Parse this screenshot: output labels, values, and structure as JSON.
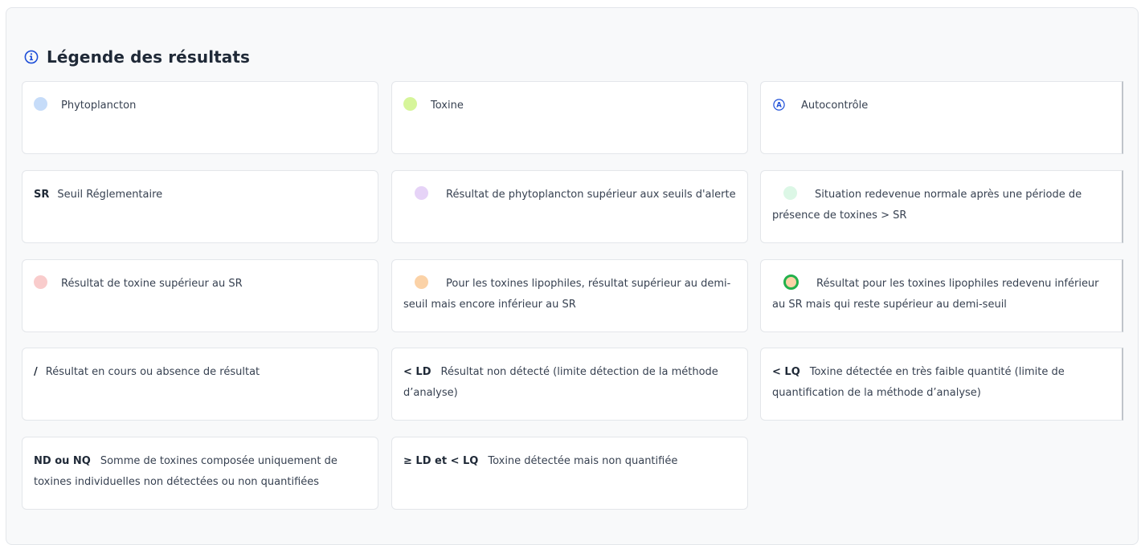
{
  "legend": {
    "title": "Légende des résultats",
    "colors": {
      "phyto": "#c6dcf9",
      "toxine": "#d6f59a",
      "alerte": "#e6d3f7",
      "normale": "#dcf7e6",
      "toxine_sr": "#f9cccc",
      "demi_seuil": "#fbd2a7",
      "ring": "#22b14c",
      "icon_blue": "#1e4fd8"
    },
    "items": [
      {
        "label": "Phytoplancton"
      },
      {
        "label": "Toxine"
      },
      {
        "label": "Autocontrôle"
      },
      {
        "code": "SR",
        "label": "Seuil Réglementaire"
      },
      {
        "label": "Résultat de phytoplancton supérieur aux seuils d'alerte"
      },
      {
        "label": "Situation redevenue normale après une période de présence de toxines > SR"
      },
      {
        "label": "Résultat de toxine supérieur au SR"
      },
      {
        "label": "Pour les toxines lipophiles, résultat supérieur au demi-seuil mais encore inférieur au SR"
      },
      {
        "label": "Résultat pour les toxines lipophiles redevenu inférieur au SR mais qui reste supérieur au demi-seuil"
      },
      {
        "code": "/",
        "label": "Résultat en cours ou absence de résultat"
      },
      {
        "code": "< LD",
        "label": "Résultat non détecté (limite détection de la méthode d’analyse)"
      },
      {
        "code": "< LQ",
        "label": "Toxine détectée en très faible quantité (limite de quantification de la méthode d’analyse)"
      },
      {
        "code": "ND ou NQ",
        "label": "Somme de toxines composée uniquement de toxines individuelles non détectées ou non quantifiées"
      },
      {
        "code": "≥ LD et < LQ",
        "label": "Toxine détectée mais non quantifiée"
      }
    ]
  }
}
